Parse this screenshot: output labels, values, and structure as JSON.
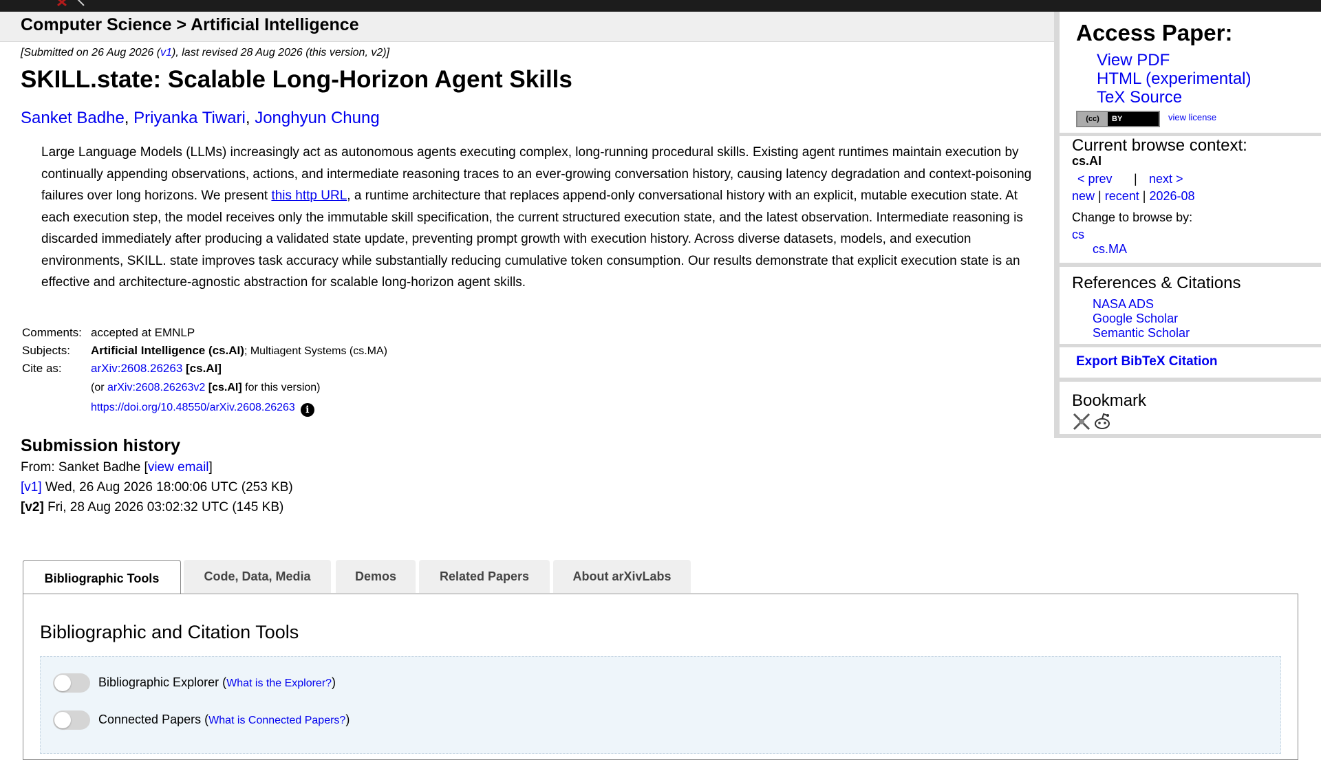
{
  "breadcrumb": {
    "category": "Computer Science",
    "separator": ">",
    "subcategory": "Artificial Intelligence"
  },
  "paper": {
    "dateline_prefix": "[Submitted on 26 Aug 2026 (",
    "dateline_v1": "v1",
    "dateline_suffix": "), last revised 28 Aug 2026 (this version, v2)]",
    "title": "SKILL.state: Scalable Long-Horizon Agent Skills",
    "authors": [
      "Sanket Badhe",
      "Priyanka Tiwari",
      "Jonghyun Chung"
    ],
    "abstract_part1": "Large Language Models (LLMs) increasingly act as autonomous agents executing complex, long-running procedural skills. Existing agent runtimes maintain execution by continually appending observations, actions, and intermediate reasoning traces to an ever-growing conversation history, causing latency degradation and context-poisoning failures over long horizons. We present ",
    "abstract_link": "this http URL",
    "abstract_part2": ", a runtime architecture that replaces append-only conversational history with an explicit, mutable execution state. At each execution step, the model receives only the immutable skill specification, the current structured execution state, and the latest observation. Intermediate reasoning is discarded immediately after producing a validated state update, preventing prompt growth with execution history. Across diverse datasets, models, and execution environments, SKILL. state improves task accuracy while substantially reducing cumulative token consumption. Our results demonstrate that explicit execution state is an effective and architecture-agnostic abstraction for scalable long-horizon agent skills."
  },
  "meta": {
    "comments_label": "Comments:",
    "comments_value": "accepted at EMNLP",
    "subjects_label": "Subjects:",
    "subjects_primary": "Artificial Intelligence (cs.AI)",
    "subjects_rest": "; Multiagent Systems (cs.MA)",
    "cite_label": "Cite as:",
    "cite_id": "arXiv:2608.26263",
    "cite_cat": "[cs.AI]",
    "cite_or_prefix": "(or ",
    "cite_version_id": "arXiv:2608.26263v2",
    "cite_version_cat": "[cs.AI]",
    "cite_version_suffix": " for this version)",
    "doi": "https://doi.org/10.48550/arXiv.2608.26263",
    "info_glyph": "i"
  },
  "history": {
    "title": "Submission history",
    "from_prefix": "From: Sanket Badhe [",
    "view_email": "view email",
    "from_suffix": "]",
    "v1_label": "[v1]",
    "v1_text": " Wed, 26 Aug 2026 18:00:06 UTC (253 KB)",
    "v2_label": "[v2]",
    "v2_text": " Fri, 28 Aug 2026 03:02:32 UTC (145 KB)"
  },
  "tabs": [
    {
      "label": "Bibliographic Tools"
    },
    {
      "label": "Code, Data, Media"
    },
    {
      "label": "Demos"
    },
    {
      "label": "Related Papers"
    },
    {
      "label": "About arXivLabs"
    }
  ],
  "panel": {
    "title": "Bibliographic and Citation Tools",
    "tools": [
      {
        "name": "Bibliographic Explorer",
        "help": "What is the Explorer?"
      },
      {
        "name": "Connected Papers",
        "help": "What is Connected Papers?"
      }
    ]
  },
  "sidebar": {
    "access_title": "Access Paper:",
    "links": [
      "View PDF",
      "HTML (experimental)",
      "TeX Source"
    ],
    "license_cc": "(cc)",
    "license_by": "BY",
    "view_license": "view license",
    "browse_title": "Current browse context:",
    "browse_context": "cs.AI",
    "prev": "< prev",
    "pipe": "|",
    "next": "next >",
    "new": "new",
    "recent": "recent",
    "month": "2026-08",
    "change_label": "Change to browse by:",
    "browse_cs": "cs",
    "browse_csma": "cs.MA",
    "refs_title": "References & Citations",
    "refs": [
      "NASA ADS",
      "Google Scholar",
      "Semantic Scholar"
    ],
    "export": "Export BibTeX Citation",
    "bookmark_title": "Bookmark"
  },
  "colors": {
    "link": "#0000ee",
    "topbar": "#1c1c1c",
    "logo_accent": "#b31b1b",
    "tool_box": "#eef5fa"
  }
}
